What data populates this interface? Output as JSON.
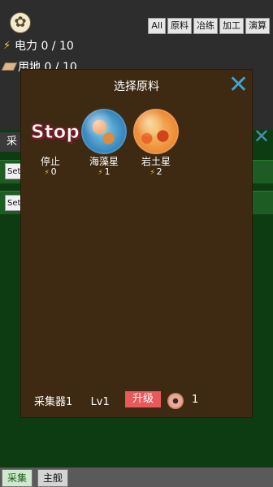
{
  "status": {
    "power": "电力 0 / 10",
    "land": "用地 0 / 10"
  },
  "filters": [
    "All",
    "原料",
    "冶练",
    "加工",
    "演算"
  ],
  "background": {
    "tab_label": "采",
    "set_label": "Set"
  },
  "modal": {
    "title": "选择原料",
    "options": [
      {
        "name": "停止",
        "cost": "0",
        "logo_text": "Stop",
        "icon": "stop-logo"
      },
      {
        "name": "海藻星",
        "cost": "1",
        "icon": "blue-planet-icon"
      },
      {
        "name": "岩土星",
        "cost": "2",
        "icon": "orange-planet-icon"
      }
    ],
    "collector": "采集器1",
    "level": "Lv1",
    "upgrade_label": "升级",
    "donut_count": "1"
  },
  "bottom_tabs": [
    "采集",
    "主舰"
  ],
  "colors": {
    "modal_bg": "#3e2a12",
    "accent_close": "#4aa0c8",
    "upgrade": "#e85a5a",
    "panel_green": "#0d3b12"
  }
}
